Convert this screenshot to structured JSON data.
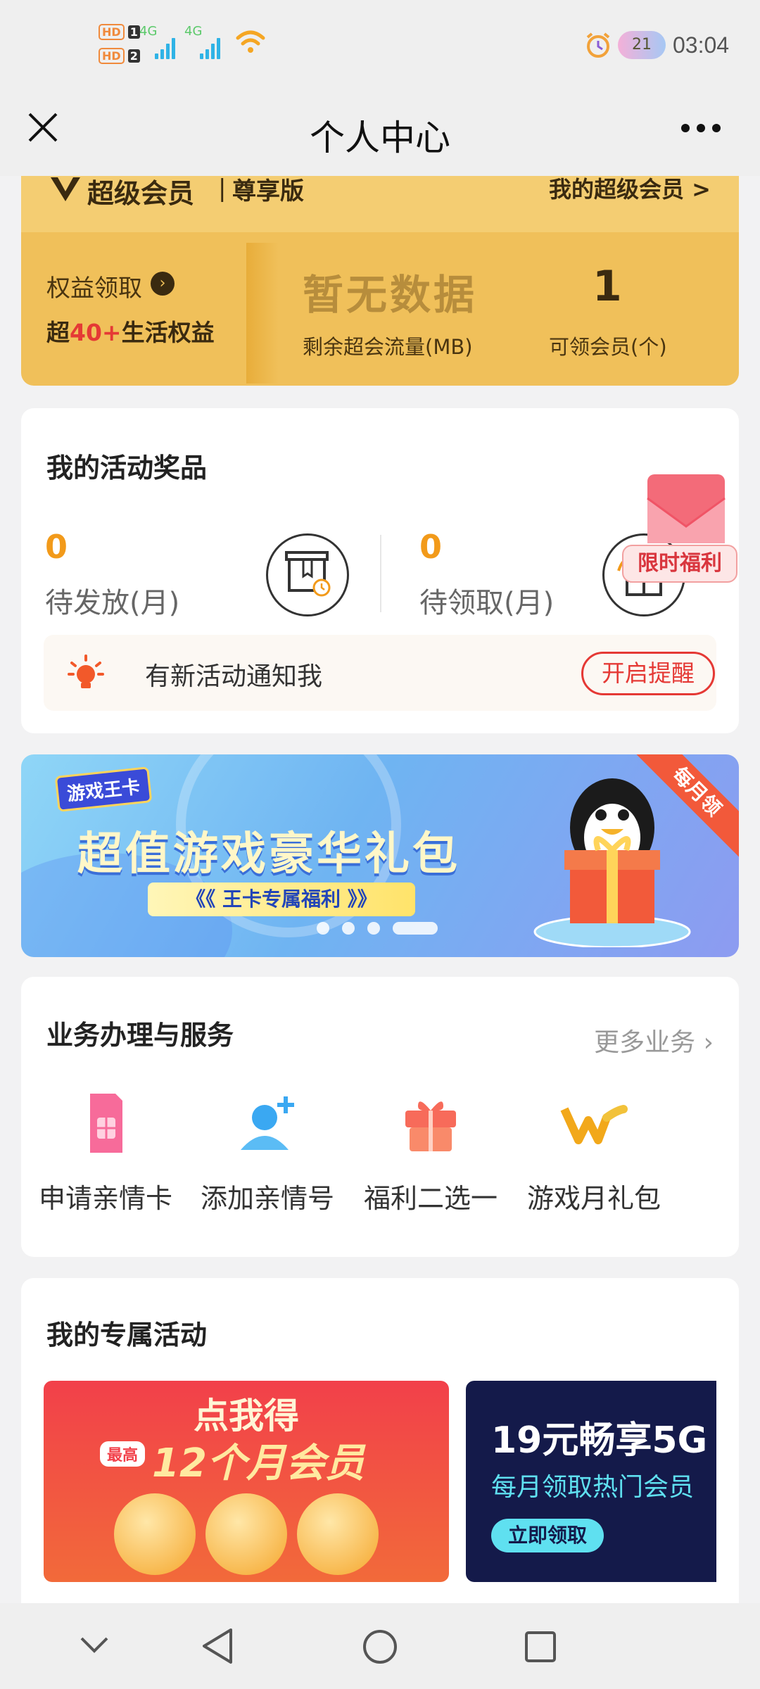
{
  "status_bar": {
    "hd_label": "HD",
    "sim1": "1",
    "sim2": "2",
    "network": "4G",
    "notification_count": "21",
    "time": "03:04"
  },
  "header": {
    "title": "个人中心"
  },
  "vip_card": {
    "brand": "超级会员",
    "edition": "尊享版",
    "link_label": "我的超级会员 >",
    "rights_label": "权益领取",
    "rights_sub_prefix": "超",
    "rights_sub_highlight": "40+",
    "rights_sub_suffix": "生活权益",
    "flow_value": "暂无数据",
    "flow_label": "剩余超会流量(MB)",
    "membership_value": "1",
    "membership_label": "可领会员(个)"
  },
  "prizes": {
    "title": "我的活动奖品",
    "pending_value": "0",
    "pending_label": "待发放(月)",
    "to_claim_value": "0",
    "to_claim_label": "待领取(月)",
    "notify_text": "有新活动通知我",
    "notify_button": "开启提醒",
    "promo_tag": "限时福利"
  },
  "banner": {
    "logo": "游戏王卡",
    "title": "超值游戏豪华礼包",
    "subtitle": "《《 王卡专属福利 》》",
    "ribbon": "每月领",
    "total_slides": 4,
    "active_slide": 4
  },
  "services": {
    "title": "业务办理与服务",
    "more_label": "更多业务",
    "items": [
      {
        "label": "申请亲情卡",
        "icon": "sim-card-icon"
      },
      {
        "label": "添加亲情号",
        "icon": "add-user-icon"
      },
      {
        "label": "福利二选一",
        "icon": "gift-icon"
      },
      {
        "label": "游戏月礼包",
        "icon": "game-w-icon"
      }
    ]
  },
  "exclusive": {
    "title": "我的专属活动",
    "promo1_title": "点我得",
    "promo1_badge": "最高",
    "promo1_main": "12个月会员",
    "promo2_title": "19元畅享5G",
    "promo2_sub": "每月领取热门会员",
    "promo2_button": "立即领取"
  },
  "colors": {
    "accent_orange": "#f29a1a",
    "accent_red": "#e53935",
    "vip_gold": "#f0c05a"
  }
}
